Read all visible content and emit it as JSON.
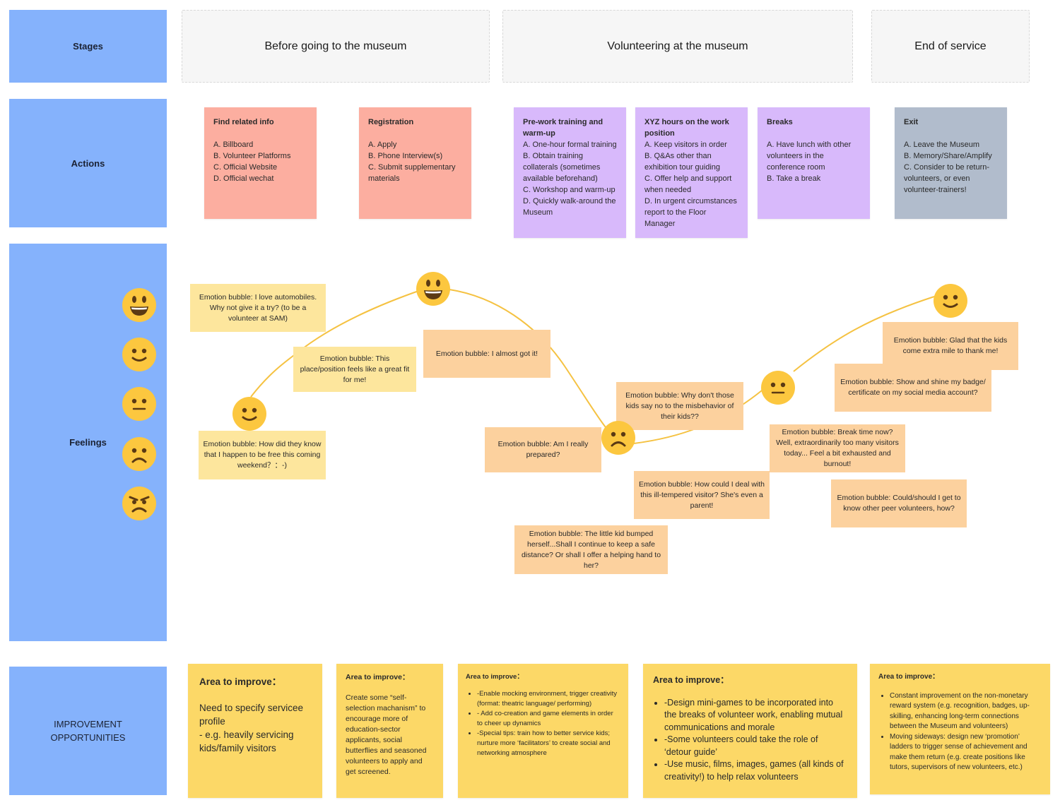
{
  "rows": {
    "stages": "Stages",
    "actions": "Actions",
    "feelings": "Feelings",
    "improvement": "IMPROVEMENT OPPORTUNITIES"
  },
  "stages": [
    "Before going to the museum",
    "Volunteering at the museum",
    "End of service"
  ],
  "actions": [
    {
      "title": "Find related info",
      "color": "#fcaea0",
      "items": [
        "A. Billboard",
        "B. Volunteer Platforms",
        "C. Official Website",
        "D. Official wechat"
      ]
    },
    {
      "title": "Registration",
      "color": "#fcaea0",
      "items": [
        "A. Apply",
        "B. Phone Interview(s)",
        "C. Submit supplementary materials"
      ]
    },
    {
      "title": "Pre-work training and warm-up",
      "color": "#d8b9fb",
      "items": [
        "A. One-hour formal training",
        "B. Obtain training collaterals (sometimes available beforehand)",
        "C. Workshop and warm-up",
        "D. Quickly walk-around the Museum"
      ]
    },
    {
      "title": "XYZ hours on the work position",
      "color": "#d8b9fb",
      "items": [
        "A. Keep visitors in order",
        "B. Q&As other than exhibition tour guiding",
        "C. Offer help and support when needed",
        "D. In urgent circumstances report to the Floor Manager"
      ]
    },
    {
      "title": "Breaks",
      "color": "#d8b9fb",
      "items": [
        "A. Have lunch with other volunteers in the conference room",
        "B. Take a break"
      ]
    },
    {
      "title": "Exit",
      "color": "#b1bccc",
      "items": [
        "A. Leave the Museum",
        "B. Memory/Share/Amplify",
        "C. Consider to be return-volunteers, or even volunteer-trainers!"
      ]
    }
  ],
  "feelings_scale": [
    "very-happy",
    "happy",
    "neutral",
    "sad",
    "angry"
  ],
  "emotion_points": [
    {
      "mood": "happy"
    },
    {
      "mood": "very-happy"
    },
    {
      "mood": "sad"
    },
    {
      "mood": "neutral"
    },
    {
      "mood": "happy"
    }
  ],
  "bubbles": [
    "Emotion bubble: I love automobiles. Why not give it a try? (to be a volunteer at SAM)",
    "Emotion bubble: This place/position feels like a great fit for me!",
    "Emotion bubble: How did they know that I happen to be free this coming weekend？：-)",
    "Emotion bubble: I almost got it!",
    "Emotion bubble: Am I really prepared?",
    "Emotion bubble: Why don't those kids say no to the misbehavior of their kids??",
    "Emotion bubble: The little kid bumped herself...Shall I continue to keep a safe distance? Or shall I offer a helping hand to her?",
    "Emotion bubble: How could I deal with this ill-tempered visitor? She's even a parent!",
    "Emotion bubble: Break time now? Well, extraordinarily too many visitors today... Feel a bit exhausted and burnout!",
    "Emotion bubble: Glad that the kids come extra mile to thank me!",
    "Emotion bubble: Show and shine my badge/ certificate on my social media account?",
    "Emotion bubble: Could/should I get to know other peer volunteers, how?"
  ],
  "improvements": [
    {
      "title": "Area to improve：",
      "lines": [
        "Need to specify servicee profile",
        "- e.g. heavily servicing kids/family visitors"
      ]
    },
    {
      "title": "Area to improve：",
      "lines": [
        "Create some “self-selection machanism” to encourage more of education-sector applicants, social butterflies and seasoned volunteers to apply and get screened."
      ]
    },
    {
      "title": "Area to improve：",
      "bullets": [
        "-Enable mocking environment, trigger creativity (format: theatric language/ performing)",
        "- Add co-creation and game elements in order to cheer up dynamics",
        "-Special tips:  train how to better service kids; nurture more ‘facilitators’ to create social and networking atmosphere"
      ]
    },
    {
      "title": "Area to improve：",
      "bullets": [
        "-Design mini-games to be incorporated into the breaks of volunteer work, enabling mutual communications and morale",
        "-Some volunteers could take the role of ‘detour guide’",
        "-Use music, films, images, games (all kinds of creativity!) to help relax volunteers"
      ]
    },
    {
      "title": "Area to improve：",
      "bullets": [
        "Constant improvement on the non-monetary reward system (e.g. recognition, badges, up-skilling, enhancing long-term connections between the Museum and volunteers)",
        "Moving sideways: design new ‘promotion’ ladders to trigger sense of achievement and make them return (e.g. create positions like tutors, supervisors of new volunteers, etc.)"
      ]
    }
  ],
  "colors": {
    "row_label": "#85b2fc",
    "action_red": "#fcaea0",
    "action_purple": "#d8b9fb",
    "action_grey": "#b1bccc",
    "bubble_light": "#fde69d",
    "bubble_orange": "#fcd19e",
    "improve_yellow": "#fcd867",
    "emoji_yellow": "#fcc73f",
    "curve": "#f5c242"
  }
}
